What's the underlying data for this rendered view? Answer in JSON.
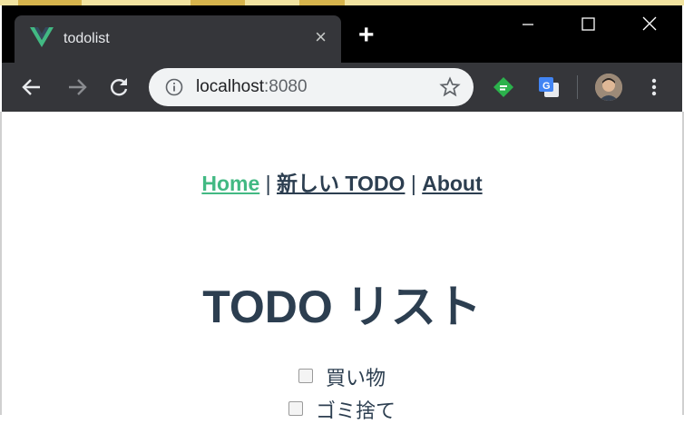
{
  "browser": {
    "tab_title": "todolist",
    "tab_close": "×",
    "new_tab": "+",
    "url_host": "localhost",
    "url_port": ":8080"
  },
  "nav": {
    "home": "Home",
    "sep1": " | ",
    "new_todo": "新しい TODO",
    "sep2": " | ",
    "about": "About"
  },
  "page": {
    "title": "TODO リスト",
    "todos": [
      {
        "label": "買い物",
        "checked": false
      },
      {
        "label": "ゴミ捨て",
        "checked": false
      }
    ]
  },
  "colors": {
    "accent": "#42b983",
    "text": "#2c3e50",
    "chrome_dark": "#35363a"
  }
}
